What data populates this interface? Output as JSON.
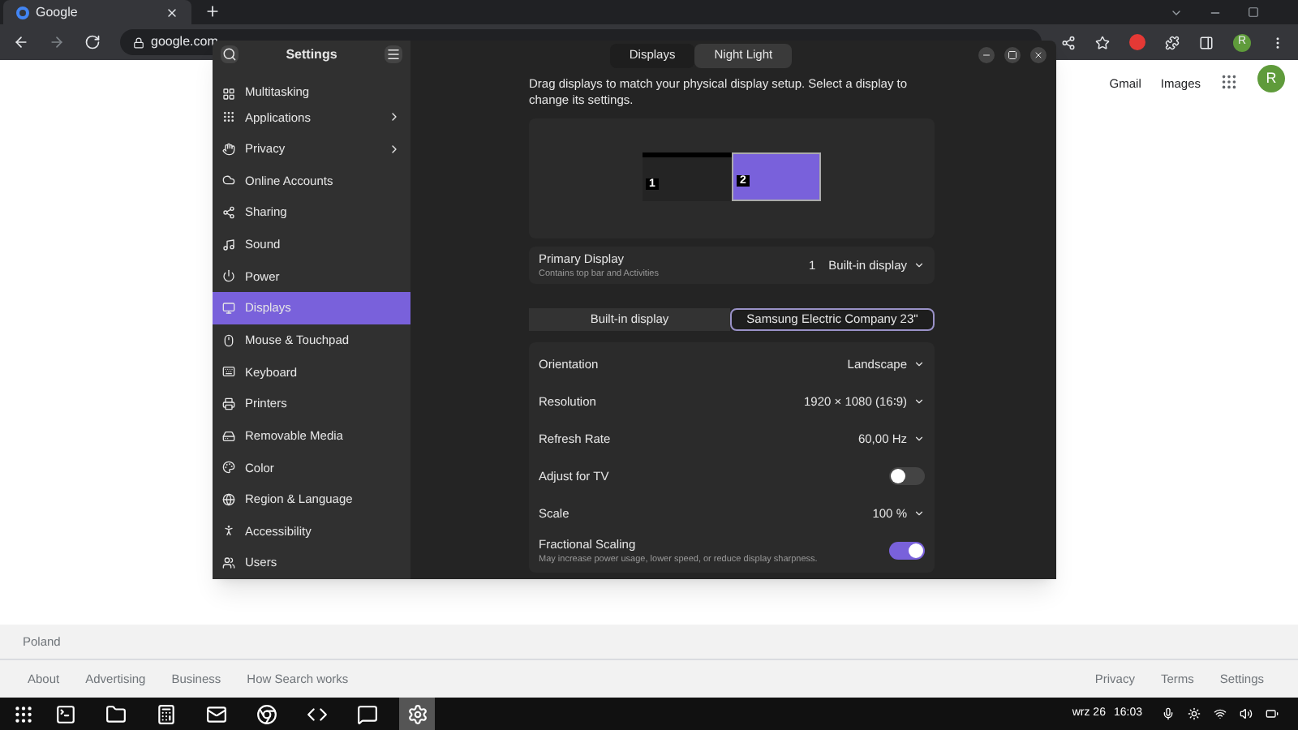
{
  "browser": {
    "tab": {
      "title": "Google",
      "selected": true
    },
    "url": "google.com",
    "profile": "R"
  },
  "google": {
    "links": [
      "Gmail",
      "Images"
    ],
    "avatar": "R",
    "country": "Poland",
    "footer_left": [
      "About",
      "Advertising",
      "Business",
      "How Search works"
    ],
    "footer_right": [
      "Privacy",
      "Terms",
      "Settings"
    ]
  },
  "settings": {
    "title": "Settings",
    "view_tabs": [
      {
        "label": "Displays",
        "selected": true
      },
      {
        "label": "Night Light",
        "selected": false
      }
    ],
    "sidebar": [
      {
        "label": "Multitasking",
        "selected": false,
        "submenu": false
      },
      {
        "label": "Applications",
        "selected": false,
        "submenu": true
      },
      {
        "label": "Privacy",
        "selected": false,
        "submenu": true
      },
      {
        "label": "Online Accounts",
        "selected": false,
        "submenu": false
      },
      {
        "label": "Sharing",
        "selected": false,
        "submenu": false
      },
      {
        "label": "Sound",
        "selected": false,
        "submenu": false
      },
      {
        "label": "Power",
        "selected": false,
        "submenu": false
      },
      {
        "label": "Displays",
        "selected": true,
        "submenu": false
      },
      {
        "label": "Mouse & Touchpad",
        "selected": false,
        "submenu": false
      },
      {
        "label": "Keyboard",
        "selected": false,
        "submenu": false
      },
      {
        "label": "Printers",
        "selected": false,
        "submenu": false
      },
      {
        "label": "Removable Media",
        "selected": false,
        "submenu": false
      },
      {
        "label": "Color",
        "selected": false,
        "submenu": false
      },
      {
        "label": "Region & Language",
        "selected": false,
        "submenu": false
      },
      {
        "label": "Accessibility",
        "selected": false,
        "submenu": false
      },
      {
        "label": "Users",
        "selected": false,
        "submenu": false
      }
    ],
    "description": "Drag displays to match your physical display setup. Select a display to change its settings.",
    "monitors": [
      {
        "number": "1",
        "selected": false,
        "primary": true
      },
      {
        "number": "2",
        "selected": true,
        "primary": false
      }
    ],
    "primary_display": {
      "label": "Primary Display",
      "subtitle": "Contains top bar and Activities",
      "number": "1",
      "value": "Built-in display"
    },
    "display_tabs": [
      {
        "label": "Built-in display",
        "selected": false
      },
      {
        "label": "Samsung Electric Company 23\"",
        "selected": true
      }
    ],
    "rows": [
      {
        "kind": "dropdown",
        "label": "Orientation",
        "value": "Landscape"
      },
      {
        "kind": "dropdown",
        "label": "Resolution",
        "value": "1920 × 1080 (16∶9)"
      },
      {
        "kind": "dropdown",
        "label": "Refresh Rate",
        "value": "60,00 Hz"
      },
      {
        "kind": "switch",
        "label": "Adjust for TV",
        "on": false
      },
      {
        "kind": "dropdown",
        "label": "Scale",
        "value": "100 %"
      },
      {
        "kind": "switch",
        "label": "Fractional Scaling",
        "subtitle": "May increase power usage, lower speed, or reduce display sharpness.",
        "on": true
      }
    ]
  },
  "taskbar": {
    "apps": [
      {
        "active": false
      },
      {
        "active": false
      },
      {
        "active": false
      },
      {
        "active": false
      },
      {
        "active": false
      },
      {
        "active": false
      },
      {
        "active": false
      },
      {
        "active": true
      }
    ],
    "date": "wrz 26",
    "time": "16:03"
  }
}
